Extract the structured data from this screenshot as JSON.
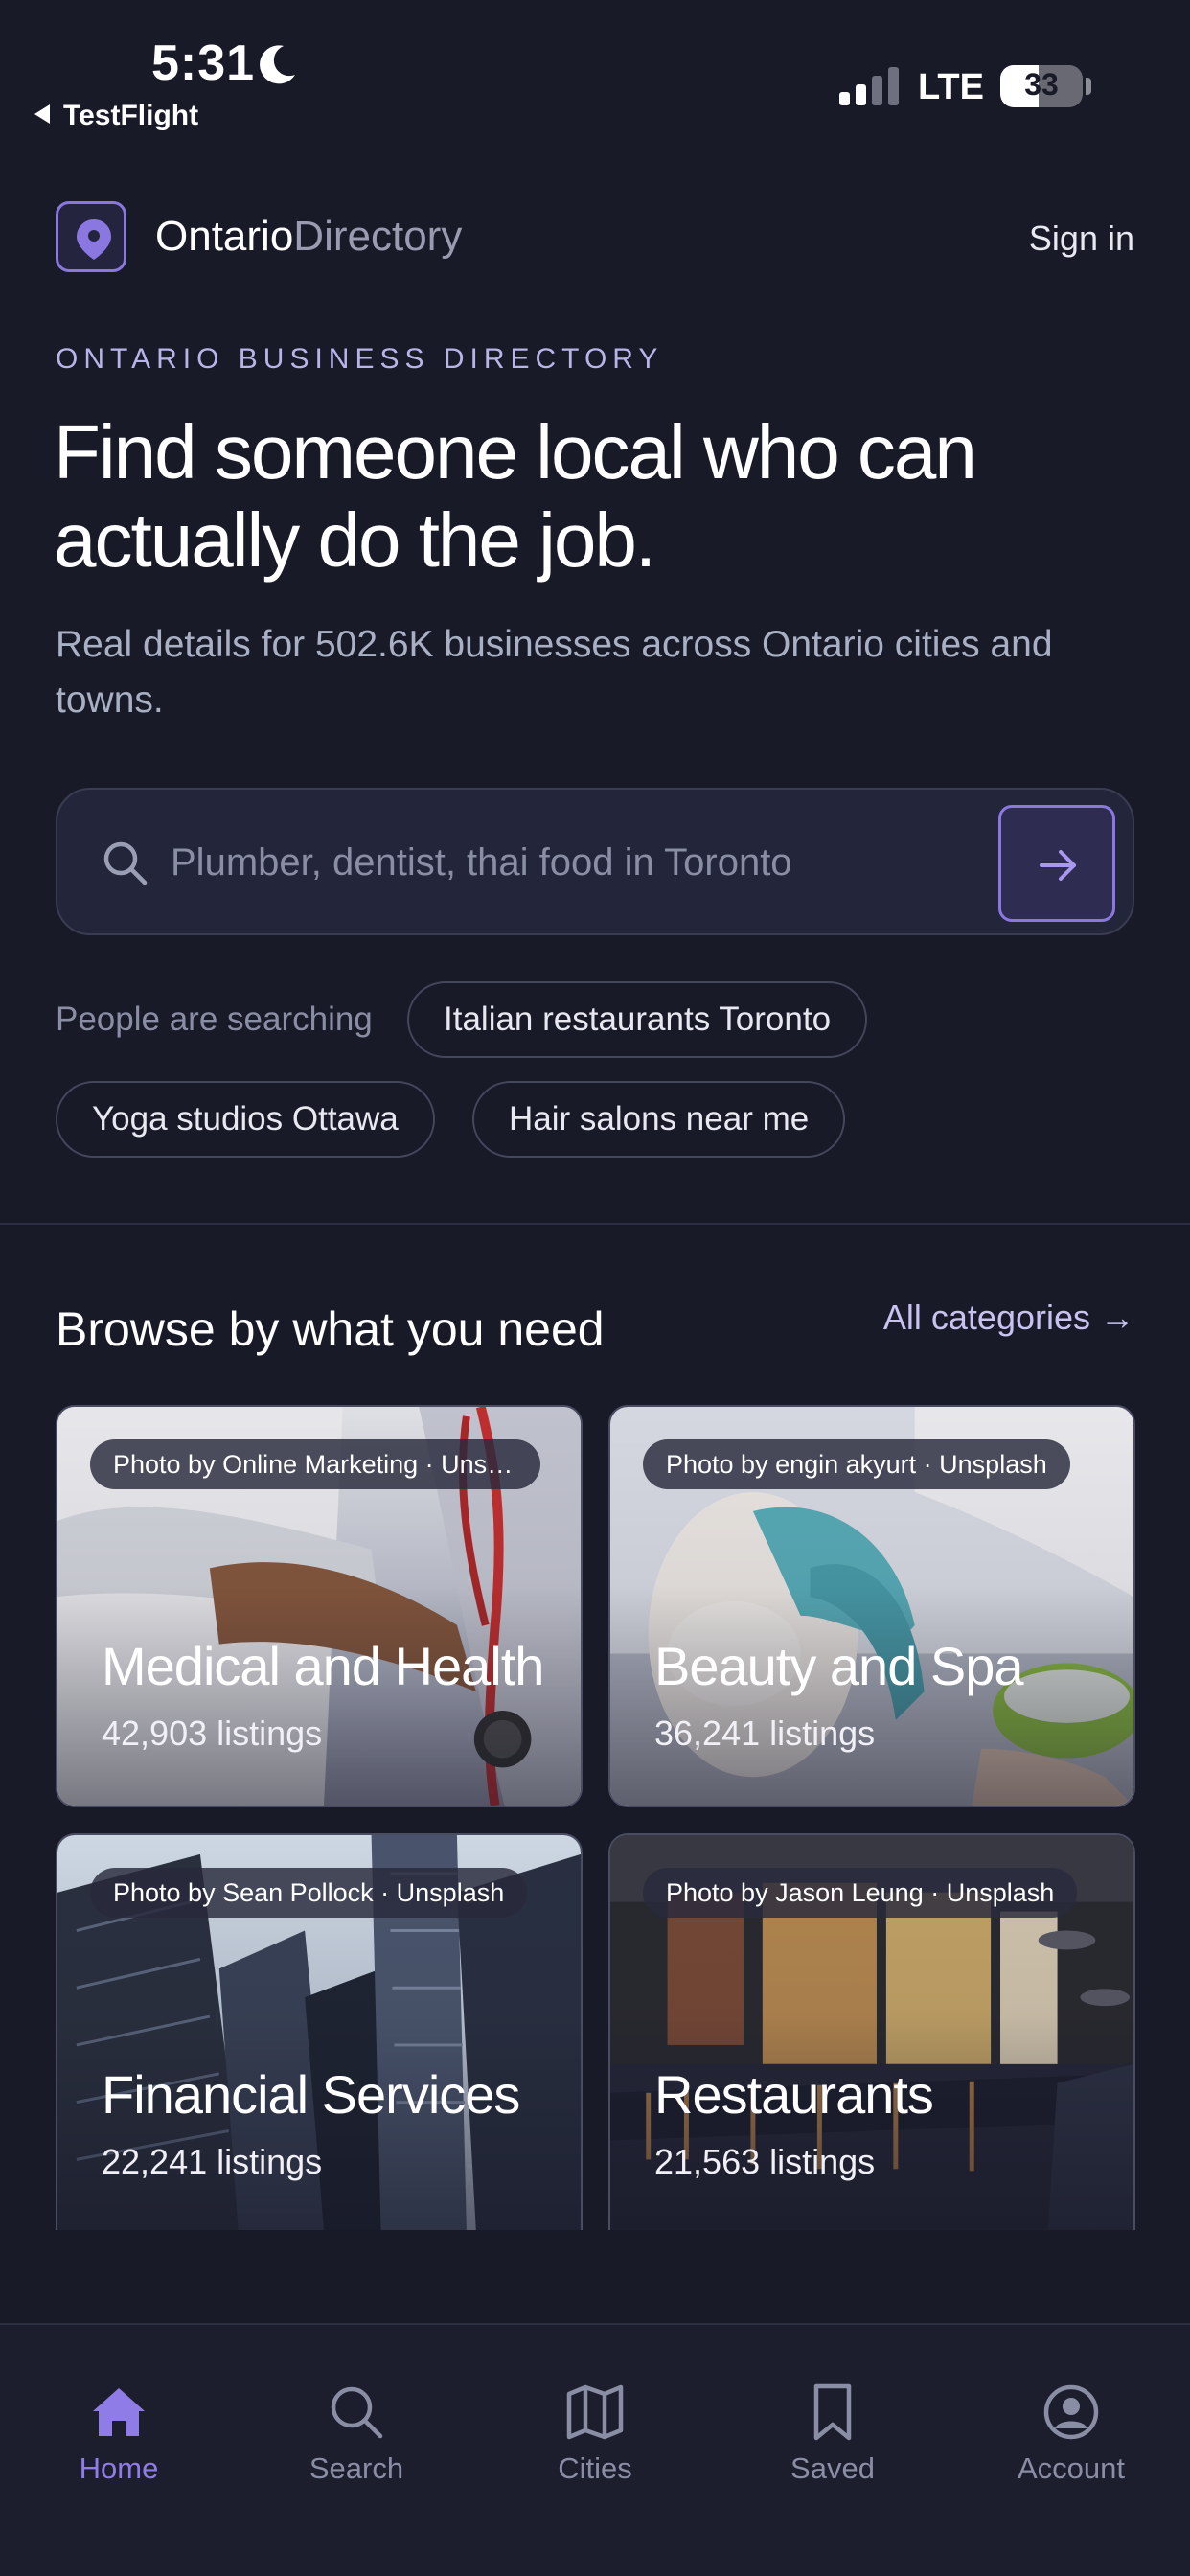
{
  "status_bar": {
    "time": "5:31",
    "back_app": "TestFlight",
    "network": "LTE",
    "battery": "33"
  },
  "header": {
    "brand_primary": "Ontario",
    "brand_secondary": "Directory",
    "sign_in": "Sign in"
  },
  "hero": {
    "eyebrow": "ONTARIO BUSINESS DIRECTORY",
    "title": "Find someone local who can actually do the job.",
    "subtitle": "Real details for 502.6K businesses across Ontario cities and towns."
  },
  "search": {
    "placeholder": "Plumber, dentist, thai food in Toronto",
    "value": ""
  },
  "popular": {
    "label": "People are searching",
    "chips": [
      "Italian restaurants Toronto",
      "Yoga studios Ottawa",
      "Hair salons near me"
    ]
  },
  "categories": {
    "title": "Browse by what you need",
    "all_link": "All categories →",
    "items": [
      {
        "credit": "Photo by Online Marketing · Unsplash",
        "name": "Medical and Health",
        "count": "42,903 listings"
      },
      {
        "credit": "Photo by engin akyurt · Unsplash",
        "name": "Beauty and Spa",
        "count": "36,241 listings"
      },
      {
        "credit": "Photo by Sean Pollock · Unsplash",
        "name": "Financial Services",
        "count": "22,241 listings"
      },
      {
        "credit": "Photo by Jason Leung · Unsplash",
        "name": "Restaurants",
        "count": "21,563 listings"
      }
    ]
  },
  "tabbar": {
    "active": "Home",
    "accent_color": "#8f7ce6",
    "items": [
      {
        "label": "Home",
        "icon": "home-icon"
      },
      {
        "label": "Search",
        "icon": "search-icon"
      },
      {
        "label": "Cities",
        "icon": "map-icon"
      },
      {
        "label": "Saved",
        "icon": "bookmark-icon"
      },
      {
        "label": "Account",
        "icon": "user-circle-icon"
      }
    ]
  },
  "colors": {
    "background": "#181a28",
    "accent": "#8a78e0"
  }
}
